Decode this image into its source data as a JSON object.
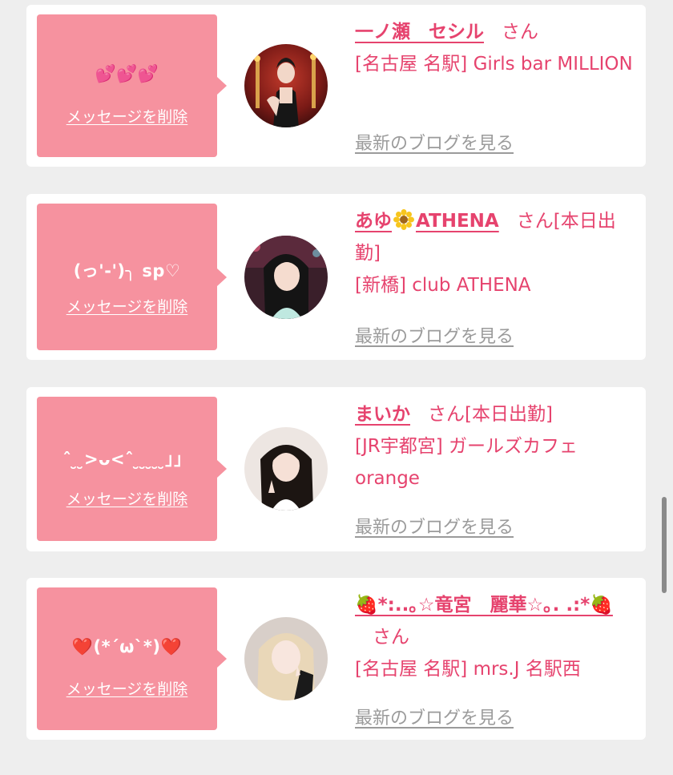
{
  "cards": [
    {
      "bubble_text": "💕💕💕",
      "delete_label": "メッセージを削除",
      "name": "一ノ瀬　セシル",
      "honorific": "さん",
      "status": "",
      "shop": "[名古屋 名駅] Girls bar MILLION",
      "blog_link": "最新のブログを見る"
    },
    {
      "bubble_text": "(っ'-')╮ sp♡",
      "delete_label": "メッセージを削除",
      "name_pre": "あゆ",
      "name_post": "ATHENA",
      "honorific": "さん",
      "status": "[本日出勤]",
      "shop": "[新橋] club ATHENA",
      "blog_link": "最新のブログを見る"
    },
    {
      "bubble_text": "ˆ ̮ ̮>ᴗ<ˆ ̮ ̮ ̮ ̮  ̮」」",
      "delete_label": "メッセージを削除",
      "name": "まいか",
      "honorific": "さん",
      "status": "[本日出勤]",
      "shop": "[JR宇都宮] ガールズカフェ orange",
      "blog_link": "最新のブログを見る"
    },
    {
      "bubble_text": "❤️(*´ω`*)❤️",
      "delete_label": "メッセージを削除",
      "name": "🍓*:..｡☆竜宮　麗華☆｡. .:*🍓",
      "honorific": "さん",
      "status": "",
      "shop": "[名古屋 名駅] mrs.J 名駅西",
      "blog_link": "最新のブログを見る"
    }
  ],
  "colors": {
    "accent": "#e6436e",
    "bubble": "#f6929f",
    "link_gray": "#9b9b9b",
    "background": "#eeeeee"
  }
}
